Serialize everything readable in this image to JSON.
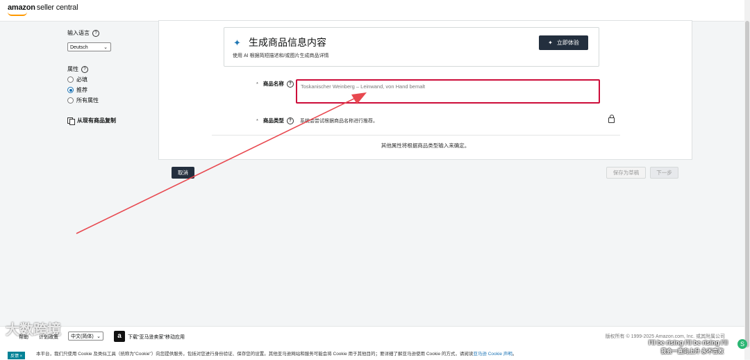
{
  "brand": {
    "name": "amazon",
    "sub": "seller central"
  },
  "sidebar": {
    "input_language_label": "输入语言",
    "language_value": "Deutsch",
    "attributes_label": "属性",
    "radio_required": "必填",
    "radio_recommended": "推荐",
    "radio_all": "所有属性",
    "copy_label": "从现有商品复制"
  },
  "ai": {
    "title": "生成商品信息内容",
    "description": "使用 AI 根据简短描述和/或图片生成商品详情",
    "button": "立即体验"
  },
  "form": {
    "name_label": "商品名称",
    "name_value": "Toskanischer Weinberg – Leinwand, von Hand bemalt",
    "type_label": "商品类型",
    "type_note": "系统会尝试根据商品名称进行推荐。",
    "other_note": "其他属性将根据商品类型输入来确定。"
  },
  "actions": {
    "cancel": "取消",
    "save_draft": "保存为草稿",
    "next": "下一步"
  },
  "footer": {
    "help": "帮助",
    "policy": "计划政策",
    "language": "中文(简体)",
    "download": "下载\"亚马逊卖家\"移动应用",
    "copyright": "版权所有 © 1999-2025 Amazon.com, Inc. 或其附属公司",
    "cookie_text": "本平台，我们只使用 Cookie 及类似工具（统称为\"Cookie\"）向您提供服务，包括对您进行身份验证、保存您的设置。其他亚马逊网站和服务可能会将 Cookie 用于其他目的；要详细了解亚马逊使用 Cookie 的方式，请阅读",
    "cookie_link": "亚马逊 Cookie 声明",
    "cookie_end": "。",
    "feedback": "反馈"
  },
  "overlay": {
    "watermark": "大数跨境",
    "lyric_1": "I'll be rising I'll be rising I'll",
    "lyric_2": "我会一直向上升 永不言败"
  }
}
